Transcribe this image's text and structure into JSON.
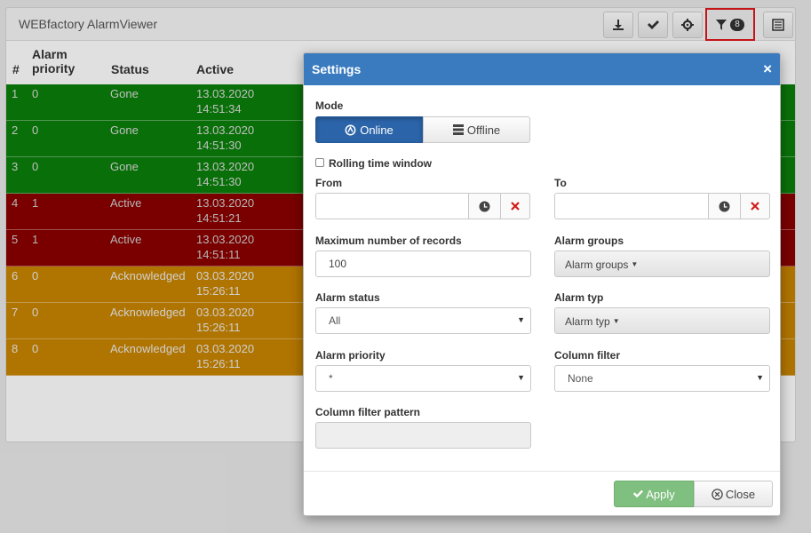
{
  "app": {
    "title": "WEBfactory AlarmViewer",
    "toolbar": {
      "export_icon": "download-icon",
      "ack_icon": "check-icon",
      "settings_icon": "gear-icon",
      "filter_icon": "filter-icon",
      "filter_count": "8",
      "columns_icon": "list-icon"
    }
  },
  "table": {
    "headers": {
      "num": "#",
      "priority": "Alarm priority",
      "status": "Status",
      "active": "Active"
    },
    "rows": [
      {
        "num": "1",
        "priority": "0",
        "status": "Gone",
        "date": "13.03.2020",
        "time": "14:51:34",
        "kind": "green"
      },
      {
        "num": "2",
        "priority": "0",
        "status": "Gone",
        "date": "13.03.2020",
        "time": "14:51:30",
        "kind": "green"
      },
      {
        "num": "3",
        "priority": "0",
        "status": "Gone",
        "date": "13.03.2020",
        "time": "14:51:30",
        "kind": "green"
      },
      {
        "num": "4",
        "priority": "1",
        "status": "Active",
        "date": "13.03.2020",
        "time": "14:51:21",
        "kind": "red"
      },
      {
        "num": "5",
        "priority": "1",
        "status": "Active",
        "date": "13.03.2020",
        "time": "14:51:11",
        "kind": "red"
      },
      {
        "num": "6",
        "priority": "0",
        "status": "Acknowledged",
        "date": "03.03.2020",
        "time": "15:26:11",
        "kind": "orange"
      },
      {
        "num": "7",
        "priority": "0",
        "status": "Acknowledged",
        "date": "03.03.2020",
        "time": "15:26:11",
        "kind": "orange"
      },
      {
        "num": "8",
        "priority": "0",
        "status": "Acknowledged",
        "date": "03.03.2020",
        "time": "15:26:11",
        "kind": "orange"
      }
    ]
  },
  "colors": {
    "gone": "#0b7f0b",
    "active": "#8b0000",
    "acknowledged": "#c98500",
    "modal_header": "#3a7bbf",
    "primary": "#2b64a8",
    "apply": "#7fbf7f"
  },
  "modal": {
    "title": "Settings",
    "close_glyph": "×",
    "mode_label": "Mode",
    "online_label": "Online",
    "offline_label": "Offline",
    "rolling_label": "Rolling time window",
    "from_label": "From",
    "to_label": "To",
    "from_value": "",
    "to_value": "",
    "max_records_label": "Maximum number of records",
    "max_records_value": "100",
    "alarm_groups_label": "Alarm groups",
    "alarm_groups_button": "Alarm groups",
    "alarm_status_label": "Alarm status",
    "alarm_status_value": "All",
    "alarm_typ_label": "Alarm typ",
    "alarm_typ_button": "Alarm typ",
    "alarm_priority_label": "Alarm priority",
    "alarm_priority_value": "*",
    "column_filter_label": "Column filter",
    "column_filter_value": "None",
    "column_filter_pattern_label": "Column filter pattern",
    "column_filter_pattern_value": "",
    "apply_label": "Apply",
    "close_label": "Close"
  }
}
